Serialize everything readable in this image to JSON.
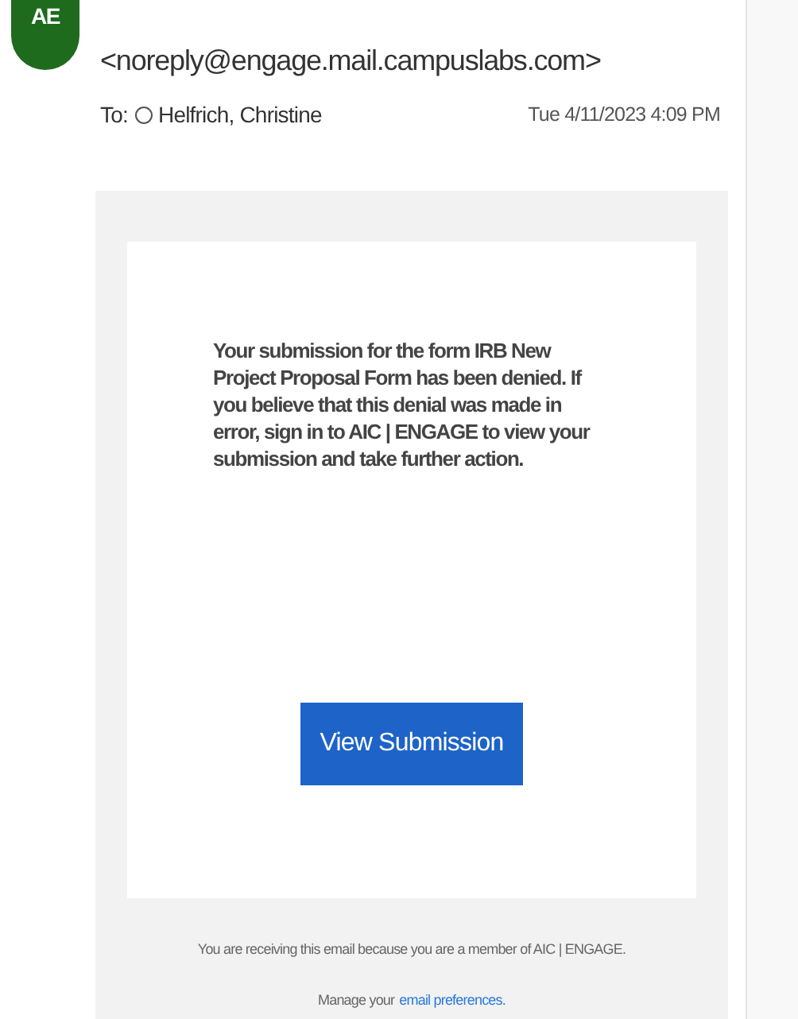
{
  "sender": {
    "initials": "AE",
    "address": "<noreply@engage.mail.campuslabs.com>"
  },
  "recipient": {
    "label": "To:",
    "name": "Helfrich, Christine"
  },
  "date": "Tue 4/11/2023 4:09 PM",
  "body": {
    "message": "Your submission for the form IRB New Project Proposal Form has been denied. If you believe that this denial was made in error, sign in to AIC | ENGAGE to view your submission and take further action.",
    "button": "View Submission"
  },
  "footer": {
    "notice": "You are receiving this email because you are a member of AIC | ENGAGE.",
    "manage": "Manage your",
    "link": "email preferences."
  }
}
